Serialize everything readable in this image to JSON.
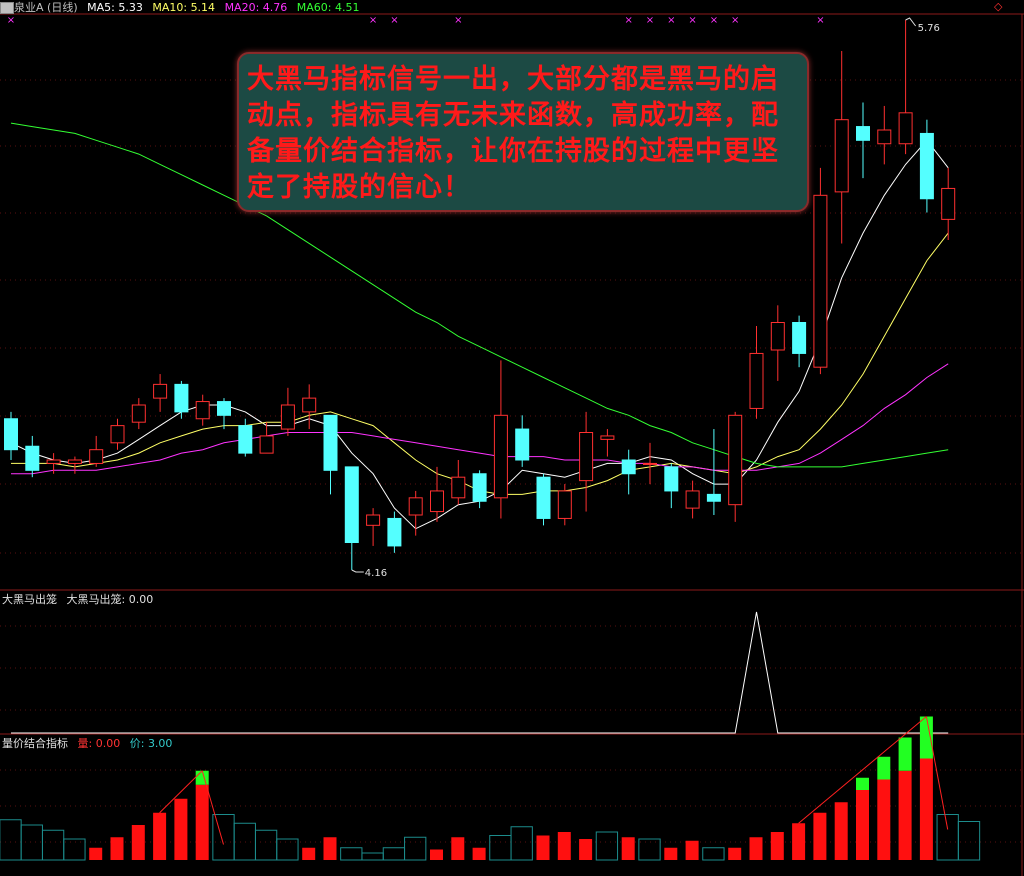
{
  "header": {
    "title": "泉业A (日线)",
    "ma5": {
      "label": "MA5:",
      "value": "5.33",
      "color": "#ffffff"
    },
    "ma10": {
      "label": "MA10:",
      "value": "5.14",
      "color": "#ffff66"
    },
    "ma20": {
      "label": "MA20:",
      "value": "4.76",
      "color": "#ff33ff"
    },
    "ma60": {
      "label": "MA60:",
      "value": "4.51",
      "color": "#33ff33"
    }
  },
  "signal_header": {
    "name": "大黑马出笼",
    "series_label": "大黑马出笼:",
    "series_value": "0.00"
  },
  "volume_header": {
    "name": "量价结合指标",
    "vol_label": "量:",
    "vol_value": "0.00",
    "price_label": "价:",
    "price_value": "3.00"
  },
  "overlay_note": {
    "text": "大黑马指标信号一出，大部分都是黑马的启动点，指标具有无未来函数，高成功率，配备量价结合指标，让你在持股的过程中更坚定了持股的信心！"
  },
  "chart_data": [
    {
      "type": "candlestick",
      "title": "泉业A (日线)",
      "high_annotation": "5.76",
      "low_annotation": "4.16",
      "candles": [
        {
          "o": 4.6,
          "c": 4.51,
          "h": 4.62,
          "l": 4.48,
          "up": false
        },
        {
          "o": 4.52,
          "c": 4.45,
          "h": 4.55,
          "l": 4.43,
          "up": false
        },
        {
          "o": 4.47,
          "c": 4.48,
          "h": 4.5,
          "l": 4.44,
          "up": true
        },
        {
          "o": 4.47,
          "c": 4.48,
          "h": 4.49,
          "l": 4.44,
          "up": true
        },
        {
          "o": 4.47,
          "c": 4.51,
          "h": 4.55,
          "l": 4.46,
          "up": true
        },
        {
          "o": 4.53,
          "c": 4.58,
          "h": 4.6,
          "l": 4.51,
          "up": true
        },
        {
          "o": 4.59,
          "c": 4.64,
          "h": 4.66,
          "l": 4.57,
          "up": true
        },
        {
          "o": 4.66,
          "c": 4.7,
          "h": 4.73,
          "l": 4.62,
          "up": true
        },
        {
          "o": 4.7,
          "c": 4.62,
          "h": 4.71,
          "l": 4.6,
          "up": false
        },
        {
          "o": 4.6,
          "c": 4.65,
          "h": 4.67,
          "l": 4.58,
          "up": true
        },
        {
          "o": 4.65,
          "c": 4.61,
          "h": 4.66,
          "l": 4.57,
          "up": false
        },
        {
          "o": 4.58,
          "c": 4.5,
          "h": 4.6,
          "l": 4.49,
          "up": false
        },
        {
          "o": 4.5,
          "c": 4.55,
          "h": 4.59,
          "l": 4.5,
          "up": true
        },
        {
          "o": 4.57,
          "c": 4.64,
          "h": 4.69,
          "l": 4.55,
          "up": true
        },
        {
          "o": 4.62,
          "c": 4.66,
          "h": 4.7,
          "l": 4.57,
          "up": true
        },
        {
          "o": 4.61,
          "c": 4.45,
          "h": 4.61,
          "l": 4.38,
          "up": false
        },
        {
          "o": 4.46,
          "c": 4.24,
          "h": 4.46,
          "l": 4.16,
          "up": false
        },
        {
          "o": 4.29,
          "c": 4.32,
          "h": 4.34,
          "l": 4.23,
          "up": true
        },
        {
          "o": 4.31,
          "c": 4.23,
          "h": 4.33,
          "l": 4.21,
          "up": false
        },
        {
          "o": 4.32,
          "c": 4.37,
          "h": 4.39,
          "l": 4.26,
          "up": true
        },
        {
          "o": 4.33,
          "c": 4.39,
          "h": 4.46,
          "l": 4.3,
          "up": true
        },
        {
          "o": 4.37,
          "c": 4.43,
          "h": 4.48,
          "l": 4.35,
          "up": true
        },
        {
          "o": 4.44,
          "c": 4.36,
          "h": 4.45,
          "l": 4.34,
          "up": false
        },
        {
          "o": 4.37,
          "c": 4.61,
          "h": 4.77,
          "l": 4.31,
          "up": true
        },
        {
          "o": 4.57,
          "c": 4.48,
          "h": 4.61,
          "l": 4.46,
          "up": false
        },
        {
          "o": 4.43,
          "c": 4.31,
          "h": 4.44,
          "l": 4.29,
          "up": false
        },
        {
          "o": 4.31,
          "c": 4.39,
          "h": 4.41,
          "l": 4.29,
          "up": true
        },
        {
          "o": 4.42,
          "c": 4.56,
          "h": 4.62,
          "l": 4.33,
          "up": true
        },
        {
          "o": 4.55,
          "c": 4.54,
          "h": 4.57,
          "l": 4.49,
          "up": true
        },
        {
          "o": 4.48,
          "c": 4.44,
          "h": 4.51,
          "l": 4.38,
          "up": false
        },
        {
          "o": 4.47,
          "c": 4.47,
          "h": 4.53,
          "l": 4.41,
          "up": true
        },
        {
          "o": 4.46,
          "c": 4.39,
          "h": 4.47,
          "l": 4.34,
          "up": false
        },
        {
          "o": 4.34,
          "c": 4.39,
          "h": 4.42,
          "l": 4.31,
          "up": true
        },
        {
          "o": 4.38,
          "c": 4.36,
          "h": 4.57,
          "l": 4.32,
          "up": false
        },
        {
          "o": 4.35,
          "c": 4.61,
          "h": 4.62,
          "l": 4.3,
          "up": true
        },
        {
          "o": 4.63,
          "c": 4.79,
          "h": 4.87,
          "l": 4.6,
          "up": true
        },
        {
          "o": 4.8,
          "c": 4.88,
          "h": 4.93,
          "l": 4.71,
          "up": true
        },
        {
          "o": 4.88,
          "c": 4.79,
          "h": 4.9,
          "l": 4.75,
          "up": false
        },
        {
          "o": 4.75,
          "c": 5.25,
          "h": 5.33,
          "l": 4.73,
          "up": true
        },
        {
          "o": 5.26,
          "c": 5.47,
          "h": 5.67,
          "l": 5.11,
          "up": true
        },
        {
          "o": 5.45,
          "c": 5.41,
          "h": 5.52,
          "l": 5.3,
          "up": false
        },
        {
          "o": 5.4,
          "c": 5.44,
          "h": 5.51,
          "l": 5.34,
          "up": true
        },
        {
          "o": 5.4,
          "c": 5.49,
          "h": 5.76,
          "l": 5.37,
          "up": true
        },
        {
          "o": 5.43,
          "c": 5.24,
          "h": 5.47,
          "l": 5.2,
          "up": false
        },
        {
          "o": 5.18,
          "c": 5.27,
          "h": 5.33,
          "l": 5.12,
          "up": true
        }
      ],
      "ma_series": [
        {
          "name": "MA5",
          "color": "#ffffff",
          "values": [
            4.53,
            4.5,
            4.48,
            4.47,
            4.48,
            4.5,
            4.54,
            4.58,
            4.62,
            4.64,
            4.64,
            4.62,
            4.58,
            4.58,
            4.6,
            4.58,
            4.5,
            4.44,
            4.34,
            4.28,
            4.31,
            4.35,
            4.36,
            4.39,
            4.45,
            4.44,
            4.43,
            4.45,
            4.47,
            4.47,
            4.49,
            4.48,
            4.44,
            4.41,
            4.41,
            4.48,
            4.59,
            4.68,
            4.83,
            5.01,
            5.14,
            5.25,
            5.34,
            5.41,
            5.33
          ]
        },
        {
          "name": "MA10",
          "color": "#ffff66",
          "values": [
            4.47,
            4.47,
            4.47,
            4.46,
            4.47,
            4.48,
            4.5,
            4.53,
            4.55,
            4.57,
            4.58,
            4.58,
            4.59,
            4.59,
            4.61,
            4.62,
            4.6,
            4.58,
            4.53,
            4.48,
            4.44,
            4.42,
            4.39,
            4.38,
            4.38,
            4.39,
            4.39,
            4.4,
            4.42,
            4.45,
            4.46,
            4.47,
            4.46,
            4.45,
            4.44,
            4.46,
            4.49,
            4.51,
            4.57,
            4.64,
            4.73,
            4.84,
            4.95,
            5.06,
            5.14
          ]
        },
        {
          "name": "MA20",
          "color": "#ff33ff",
          "values": [
            4.44,
            4.44,
            4.45,
            4.45,
            4.45,
            4.46,
            4.47,
            4.48,
            4.5,
            4.51,
            4.53,
            4.54,
            4.55,
            4.56,
            4.56,
            4.56,
            4.56,
            4.55,
            4.54,
            4.53,
            4.52,
            4.51,
            4.5,
            4.49,
            4.49,
            4.49,
            4.48,
            4.48,
            4.48,
            4.47,
            4.47,
            4.46,
            4.46,
            4.45,
            4.45,
            4.45,
            4.46,
            4.47,
            4.5,
            4.54,
            4.58,
            4.63,
            4.67,
            4.72,
            4.76
          ]
        },
        {
          "name": "MA60",
          "color": "#33ff33",
          "values": [
            5.46,
            5.45,
            5.44,
            5.43,
            5.41,
            5.39,
            5.37,
            5.34,
            5.31,
            5.28,
            5.25,
            5.22,
            5.19,
            5.15,
            5.11,
            5.07,
            5.03,
            4.99,
            4.95,
            4.91,
            4.88,
            4.84,
            4.81,
            4.78,
            4.75,
            4.72,
            4.69,
            4.66,
            4.63,
            4.61,
            4.58,
            4.56,
            4.53,
            4.51,
            4.49,
            4.47,
            4.46,
            4.46,
            4.46,
            4.46,
            4.47,
            4.48,
            4.49,
            4.5,
            4.51
          ]
        }
      ],
      "signal_marker_indices": [
        0,
        17,
        18,
        21,
        29,
        30,
        31,
        32,
        33,
        34,
        38
      ]
    },
    {
      "type": "line",
      "title": "大黑马出笼",
      "series": [
        {
          "name": "大黑马出笼",
          "values": [
            0,
            0,
            0,
            0,
            0,
            0,
            0,
            0,
            0,
            0,
            0,
            0,
            0,
            0,
            0,
            0,
            0,
            0,
            0,
            0,
            0,
            0,
            0,
            0,
            0,
            0,
            0,
            0,
            0,
            0,
            0,
            0,
            0,
            0,
            0,
            1,
            0,
            0,
            0,
            0,
            0,
            0,
            0,
            0,
            0
          ]
        }
      ]
    },
    {
      "type": "bar",
      "title": "量价结合指标",
      "bars": [
        {
          "v": 2.3,
          "red": false
        },
        {
          "v": 2.0,
          "red": false
        },
        {
          "v": 1.7,
          "red": false
        },
        {
          "v": 1.2,
          "red": false
        },
        {
          "v": 0.7,
          "red": true
        },
        {
          "v": 1.3,
          "red": true
        },
        {
          "v": 2.0,
          "red": true
        },
        {
          "v": 2.7,
          "red": true
        },
        {
          "v": 3.5,
          "red": true
        },
        {
          "v": 4.3,
          "red": true,
          "peak": 0.8
        },
        {
          "v": 2.6,
          "red": false
        },
        {
          "v": 2.1,
          "red": false
        },
        {
          "v": 1.7,
          "red": false
        },
        {
          "v": 1.2,
          "red": false
        },
        {
          "v": 0.7,
          "red": true
        },
        {
          "v": 1.3,
          "red": true
        },
        {
          "v": 0.7,
          "red": false
        },
        {
          "v": 0.4,
          "red": false
        },
        {
          "v": 0.7,
          "red": false
        },
        {
          "v": 1.3,
          "red": false
        },
        {
          "v": 0.6,
          "red": true
        },
        {
          "v": 1.3,
          "red": true
        },
        {
          "v": 0.7,
          "red": true
        },
        {
          "v": 1.4,
          "red": false
        },
        {
          "v": 1.9,
          "red": false
        },
        {
          "v": 1.4,
          "red": true
        },
        {
          "v": 1.6,
          "red": true
        },
        {
          "v": 1.2,
          "red": true
        },
        {
          "v": 1.6,
          "red": false
        },
        {
          "v": 1.3,
          "red": true
        },
        {
          "v": 1.2,
          "red": false
        },
        {
          "v": 0.7,
          "red": true
        },
        {
          "v": 1.1,
          "red": true
        },
        {
          "v": 0.7,
          "red": false
        },
        {
          "v": 0.7,
          "red": true
        },
        {
          "v": 1.3,
          "red": true
        },
        {
          "v": 1.6,
          "red": true
        },
        {
          "v": 2.1,
          "red": true
        },
        {
          "v": 2.7,
          "red": true
        },
        {
          "v": 3.3,
          "red": true
        },
        {
          "v": 4.0,
          "red": true,
          "peak": 0.7
        },
        {
          "v": 4.6,
          "red": true,
          "peak": 1.3
        },
        {
          "v": 5.1,
          "red": true,
          "peak": 1.9
        },
        {
          "v": 5.8,
          "red": true,
          "peak": 2.4
        },
        {
          "v": 2.6,
          "red": false
        },
        {
          "v": 2.2,
          "red": false
        }
      ]
    }
  ]
}
